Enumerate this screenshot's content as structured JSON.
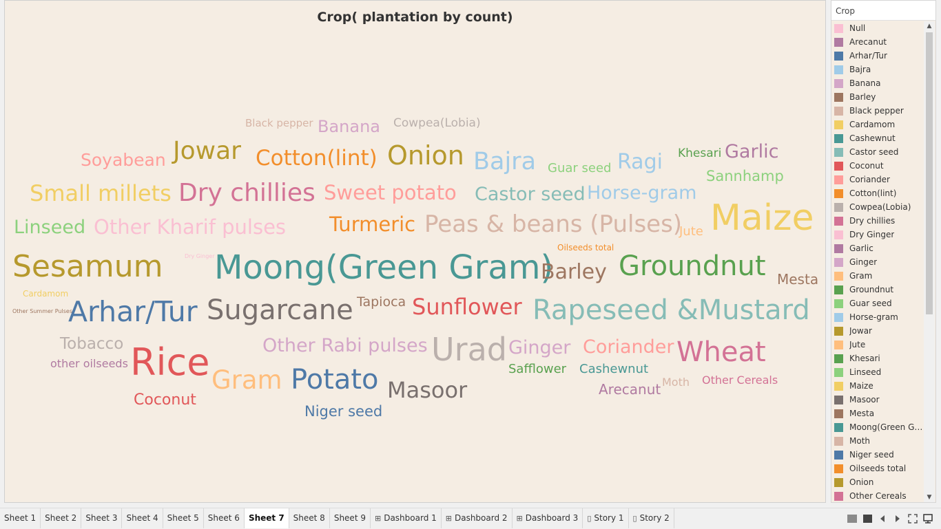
{
  "viz": {
    "title": "Crop( plantation by count)"
  },
  "chart_data": {
    "type": "wordcloud",
    "title": "Crop( plantation by count)",
    "words": [
      {
        "text": "Black pepper",
        "color": "#d7b5a6",
        "size": 15
      },
      {
        "text": "Banana",
        "color": "#d4a6c8",
        "size": 24
      },
      {
        "text": "Cowpea(Lobia)",
        "color": "#bab0ac",
        "size": 17
      },
      {
        "text": "Soyabean",
        "color": "#ff9d9a",
        "size": 25
      },
      {
        "text": "Jowar",
        "color": "#b6992d",
        "size": 36
      },
      {
        "text": "Cotton(lint)",
        "color": "#f28e2b",
        "size": 31
      },
      {
        "text": "Onion",
        "color": "#b6992d",
        "size": 38
      },
      {
        "text": "Bajra",
        "color": "#a0cbe8",
        "size": 35
      },
      {
        "text": "Guar seed",
        "color": "#8cd17d",
        "size": 18
      },
      {
        "text": "Ragi",
        "color": "#a0cbe8",
        "size": 30
      },
      {
        "text": "Khesari",
        "color": "#59a14f",
        "size": 17
      },
      {
        "text": "Garlic",
        "color": "#b07aa1",
        "size": 27
      },
      {
        "text": "Sannhamp",
        "color": "#8cd17d",
        "size": 21
      },
      {
        "text": "Small millets",
        "color": "#f1ce63",
        "size": 32
      },
      {
        "text": "Dry chillies",
        "color": "#d37295",
        "size": 36
      },
      {
        "text": "Sweet potato",
        "color": "#ff9d9a",
        "size": 29
      },
      {
        "text": "Castor seed",
        "color": "#86bcb6",
        "size": 27
      },
      {
        "text": "Horse-gram",
        "color": "#a0cbe8",
        "size": 27
      },
      {
        "text": "Maize",
        "color": "#f1ce63",
        "size": 52
      },
      {
        "text": "Linseed",
        "color": "#8cd17d",
        "size": 27
      },
      {
        "text": "Other Kharif pulses",
        "color": "#fabfd2",
        "size": 29
      },
      {
        "text": "Turmeric",
        "color": "#f28e2b",
        "size": 29
      },
      {
        "text": "Peas & beans (Pulses)",
        "color": "#d7b5a6",
        "size": 34
      },
      {
        "text": "Jute",
        "color": "#ffbe7d",
        "size": 18
      },
      {
        "text": "Oilseeds total",
        "color": "#f28e2b",
        "size": 12
      },
      {
        "text": "Sesamum",
        "color": "#b6992d",
        "size": 44
      },
      {
        "text": "Dry Ginger",
        "color": "#fabfd2",
        "size": 8
      },
      {
        "text": "Moong(Green Gram)",
        "color": "#499894",
        "size": 48
      },
      {
        "text": "Barley",
        "color": "#9d7660",
        "size": 30
      },
      {
        "text": "Groundnut",
        "color": "#59a14f",
        "size": 40
      },
      {
        "text": "Mesta",
        "color": "#9d7660",
        "size": 20
      },
      {
        "text": "Cardamom",
        "color": "#f1ce63",
        "size": 12
      },
      {
        "text": "Other Summer Pulses",
        "color": "#9d7660",
        "size": 8
      },
      {
        "text": "Arhar/Tur",
        "color": "#4e79a7",
        "size": 41
      },
      {
        "text": "Sugarcane",
        "color": "#79706e",
        "size": 40
      },
      {
        "text": "Tapioca",
        "color": "#9d7660",
        "size": 19
      },
      {
        "text": "Sunflower",
        "color": "#e15759",
        "size": 32
      },
      {
        "text": "Rapeseed &Mustard",
        "color": "#86bcb6",
        "size": 40
      },
      {
        "text": "Tobacco",
        "color": "#bab0ac",
        "size": 23
      },
      {
        "text": "Rice",
        "color": "#e15759",
        "size": 54
      },
      {
        "text": "Other Rabi pulses",
        "color": "#d4a6c8",
        "size": 27
      },
      {
        "text": "Urad",
        "color": "#bab0ac",
        "size": 46
      },
      {
        "text": "Ginger",
        "color": "#d4a6c8",
        "size": 27
      },
      {
        "text": "Coriander",
        "color": "#ff9d9a",
        "size": 27
      },
      {
        "text": "Wheat",
        "color": "#d37295",
        "size": 40
      },
      {
        "text": "other oilseeds",
        "color": "#b07aa1",
        "size": 16
      },
      {
        "text": "Safflower",
        "color": "#59a14f",
        "size": 18
      },
      {
        "text": "Cashewnut",
        "color": "#499894",
        "size": 18
      },
      {
        "text": "Gram",
        "color": "#ffbe7d",
        "size": 37
      },
      {
        "text": "Potato",
        "color": "#4e79a7",
        "size": 40
      },
      {
        "text": "Masoor",
        "color": "#79706e",
        "size": 32
      },
      {
        "text": "Moth",
        "color": "#d7b5a6",
        "size": 16
      },
      {
        "text": "Other Cereals",
        "color": "#d37295",
        "size": 16
      },
      {
        "text": "Arecanut",
        "color": "#b07aa1",
        "size": 20
      },
      {
        "text": "Coconut",
        "color": "#e15759",
        "size": 22
      },
      {
        "text": "Niger seed",
        "color": "#4e79a7",
        "size": 21
      }
    ]
  },
  "legend": {
    "title": "Crop",
    "items": [
      {
        "label": "Null",
        "color": "#fabfd2"
      },
      {
        "label": "Arecanut",
        "color": "#b07aa1"
      },
      {
        "label": "Arhar/Tur",
        "color": "#4e79a7"
      },
      {
        "label": "Bajra",
        "color": "#a0cbe8"
      },
      {
        "label": "Banana",
        "color": "#d4a6c8"
      },
      {
        "label": "Barley",
        "color": "#9d7660"
      },
      {
        "label": "Black pepper",
        "color": "#d7b5a6"
      },
      {
        "label": "Cardamom",
        "color": "#f1ce63"
      },
      {
        "label": "Cashewnut",
        "color": "#499894"
      },
      {
        "label": "Castor seed",
        "color": "#86bcb6"
      },
      {
        "label": "Coconut",
        "color": "#e15759"
      },
      {
        "label": "Coriander",
        "color": "#ff9d9a"
      },
      {
        "label": "Cotton(lint)",
        "color": "#f28e2b"
      },
      {
        "label": "Cowpea(Lobia)",
        "color": "#bab0ac"
      },
      {
        "label": "Dry chillies",
        "color": "#d37295"
      },
      {
        "label": "Dry Ginger",
        "color": "#fabfd2"
      },
      {
        "label": "Garlic",
        "color": "#b07aa1"
      },
      {
        "label": "Ginger",
        "color": "#d4a6c8"
      },
      {
        "label": "Gram",
        "color": "#ffbe7d"
      },
      {
        "label": "Groundnut",
        "color": "#59a14f"
      },
      {
        "label": "Guar seed",
        "color": "#8cd17d"
      },
      {
        "label": "Horse-gram",
        "color": "#a0cbe8"
      },
      {
        "label": "Jowar",
        "color": "#b6992d"
      },
      {
        "label": "Jute",
        "color": "#ffbe7d"
      },
      {
        "label": "Khesari",
        "color": "#59a14f"
      },
      {
        "label": "Linseed",
        "color": "#8cd17d"
      },
      {
        "label": "Maize",
        "color": "#f1ce63"
      },
      {
        "label": "Masoor",
        "color": "#79706e"
      },
      {
        "label": "Mesta",
        "color": "#9d7660"
      },
      {
        "label": "Moong(Green Gra..",
        "color": "#499894"
      },
      {
        "label": "Moth",
        "color": "#d7b5a6"
      },
      {
        "label": "Niger seed",
        "color": "#4e79a7"
      },
      {
        "label": "Oilseeds total",
        "color": "#f28e2b"
      },
      {
        "label": "Onion",
        "color": "#b6992d"
      },
      {
        "label": "Other Cereals",
        "color": "#d37295"
      }
    ]
  },
  "tabs": [
    {
      "label": "Sheet 1",
      "icon": ""
    },
    {
      "label": "Sheet 2",
      "icon": ""
    },
    {
      "label": "Sheet 3",
      "icon": ""
    },
    {
      "label": "Sheet 4",
      "icon": ""
    },
    {
      "label": "Sheet 5",
      "icon": ""
    },
    {
      "label": "Sheet 6",
      "icon": ""
    },
    {
      "label": "Sheet 7",
      "icon": "",
      "active": true
    },
    {
      "label": "Sheet 8",
      "icon": ""
    },
    {
      "label": "Sheet 9",
      "icon": ""
    },
    {
      "label": "Dashboard 1",
      "icon": "dashboard-icon"
    },
    {
      "label": "Dashboard 2",
      "icon": "dashboard-icon"
    },
    {
      "label": "Dashboard 3",
      "icon": "dashboard-icon"
    },
    {
      "label": "Story 1",
      "icon": "story-icon"
    },
    {
      "label": "Story 2",
      "icon": "story-icon"
    }
  ],
  "toolbar": {
    "icons": [
      "sheet-sorter-icon",
      "filmstrip-icon",
      "prev-sheet-icon",
      "next-sheet-icon",
      "fit-icon",
      "presentation-icon"
    ]
  }
}
